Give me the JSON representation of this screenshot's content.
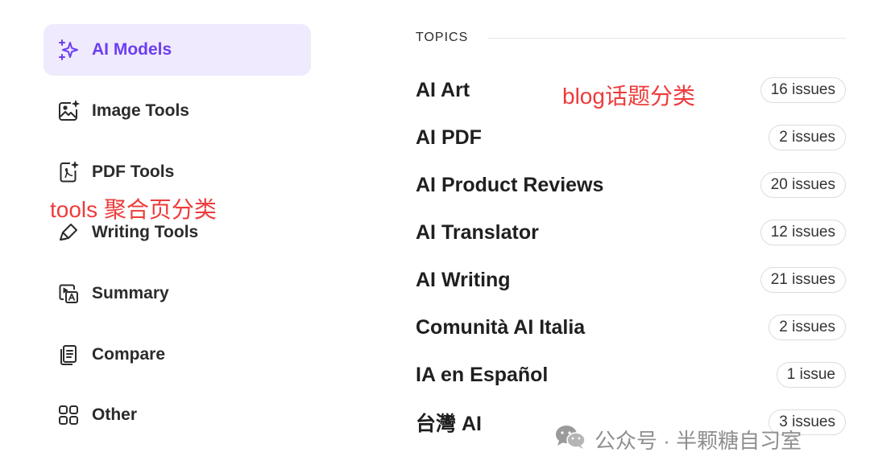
{
  "sidebar": {
    "items": [
      {
        "label": "AI Models",
        "icon": "sparkles-icon",
        "active": true
      },
      {
        "label": "Image Tools",
        "icon": "image-sparkle-icon"
      },
      {
        "label": "PDF Tools",
        "icon": "pdf-sparkle-icon"
      },
      {
        "label": "Writing Tools",
        "icon": "pen-icon"
      },
      {
        "label": "Summary",
        "icon": "summary-icon"
      },
      {
        "label": "Compare",
        "icon": "compare-icon"
      },
      {
        "label": "Other",
        "icon": "grid-icon"
      }
    ]
  },
  "annotations": {
    "tools": "tools 聚合页分类",
    "blog": "blog话题分类"
  },
  "topics": {
    "title": "TOPICS",
    "items": [
      {
        "name": "AI Art",
        "count": "16 issues"
      },
      {
        "name": "AI PDF",
        "count": "2 issues"
      },
      {
        "name": "AI Product Reviews",
        "count": "20 issues"
      },
      {
        "name": "AI Translator",
        "count": "12 issues"
      },
      {
        "name": "AI Writing",
        "count": "21 issues"
      },
      {
        "name": "Comunità AI Italia",
        "count": "2 issues"
      },
      {
        "name": "IA en Español",
        "count": "1 issue"
      },
      {
        "name": "台灣 AI",
        "count": "3 issues"
      }
    ]
  },
  "watermark": {
    "text": "公众号 · 半颗糖自习室",
    "icon": "wechat-icon"
  },
  "colors": {
    "accent": "#6c3ef2",
    "active_bg": "#efeafd",
    "annotation": "#ee3b3b"
  }
}
